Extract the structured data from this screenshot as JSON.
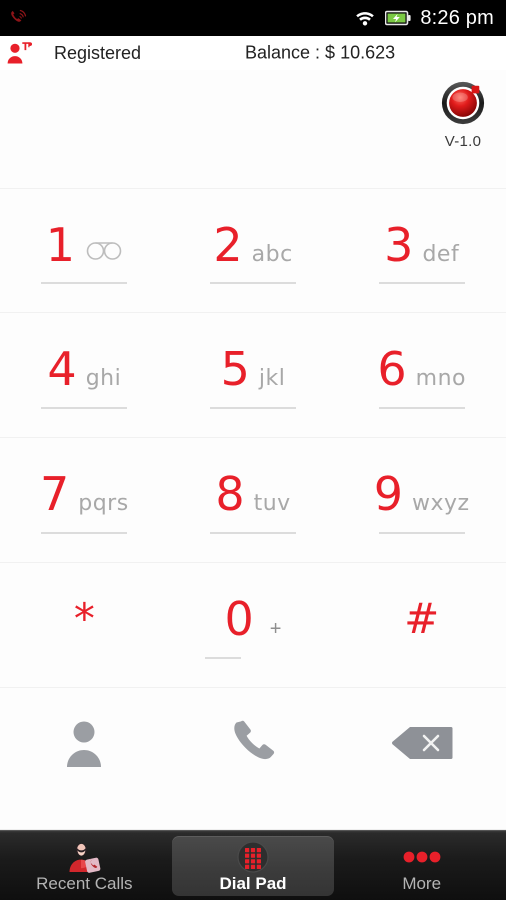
{
  "statusbar": {
    "voip_icon": "phone-waves-icon",
    "wifi_icon": "wifi-icon",
    "battery_icon": "battery-charging-icon",
    "time": "8:26 pm"
  },
  "account_bar": {
    "user_icon": "registered-user-icon",
    "status": "Registered",
    "balance": "Balance : $  10.623"
  },
  "record": {
    "icon": "record-button-icon",
    "version": "V-1.0"
  },
  "keypad": {
    "rows": [
      [
        {
          "digit": "1",
          "letters": "",
          "icon": "voicemail-icon",
          "underline": "full"
        },
        {
          "digit": "2",
          "letters": "abc",
          "icon": "",
          "underline": "full"
        },
        {
          "digit": "3",
          "letters": "def",
          "icon": "",
          "underline": "full"
        }
      ],
      [
        {
          "digit": "4",
          "letters": "ghi",
          "icon": "",
          "underline": "full"
        },
        {
          "digit": "5",
          "letters": "jkl",
          "icon": "",
          "underline": "full"
        },
        {
          "digit": "6",
          "letters": "mno",
          "icon": "",
          "underline": "full"
        }
      ],
      [
        {
          "digit": "7",
          "letters": "pqrs",
          "icon": "",
          "underline": "full"
        },
        {
          "digit": "8",
          "letters": "tuv",
          "icon": "",
          "underline": "full"
        },
        {
          "digit": "9",
          "letters": "wxyz",
          "icon": "",
          "underline": "full"
        }
      ],
      [
        {
          "digit": "*",
          "letters": "",
          "icon": "",
          "underline": "none"
        },
        {
          "digit": "0",
          "letters": "",
          "plus": "+",
          "icon": "",
          "underline": "short"
        },
        {
          "digit": "#",
          "letters": "",
          "icon": "",
          "underline": "none"
        }
      ]
    ]
  },
  "actions": [
    {
      "name": "contacts",
      "icon": "contact-person-icon"
    },
    {
      "name": "call",
      "icon": "phone-handset-icon"
    },
    {
      "name": "backspace",
      "icon": "backspace-icon"
    }
  ],
  "tabs": [
    {
      "label": "Recent Calls",
      "icon": "recent-calls-icon",
      "selected": false
    },
    {
      "label": "Dial Pad",
      "icon": "dialpad-grid-icon",
      "selected": true
    },
    {
      "label": "More",
      "icon": "more-dots-icon",
      "selected": false
    }
  ],
  "colors": {
    "accent_red": "#e8202a",
    "letters_gray": "#a8a8a8",
    "status_bar_bg": "#000000",
    "tabbar_bg": "#1b1b1b",
    "page_bg": "#fdfdfd"
  }
}
